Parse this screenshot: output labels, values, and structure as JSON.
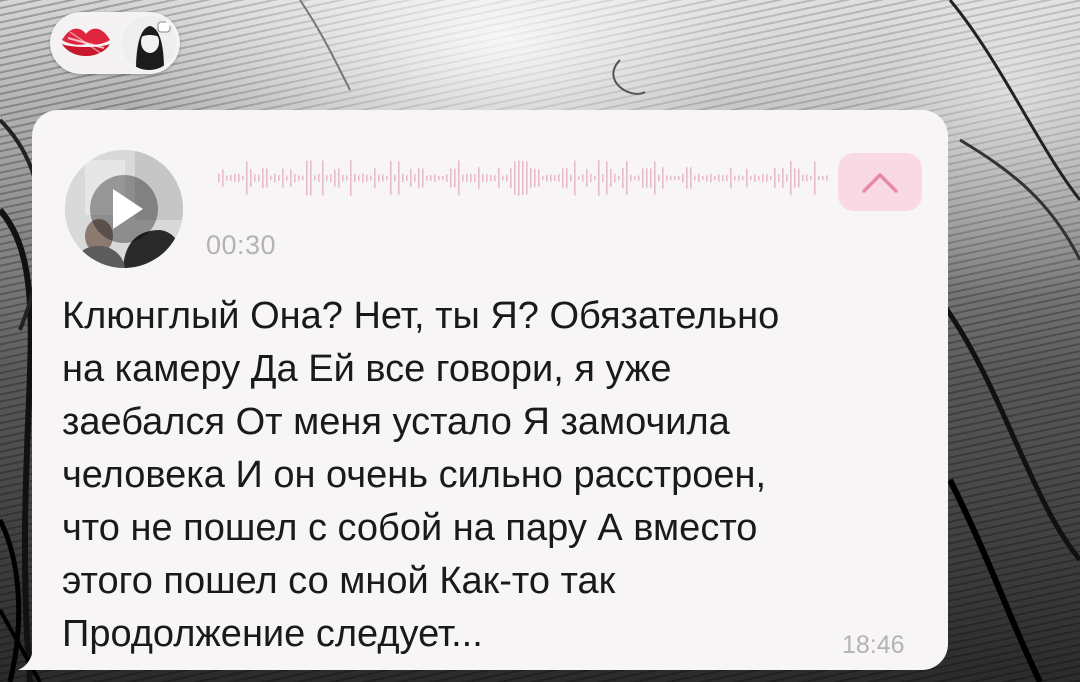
{
  "reactions": {
    "items": [
      {
        "icon": "lips-icon",
        "color": "#e0263e"
      },
      {
        "icon": "user-avatar"
      }
    ]
  },
  "message": {
    "attachment": {
      "type": "video-note",
      "duration": "00:30"
    },
    "transcript": "Клюнглый Она? Нет, ты Я? Обязательно\nна камеру Да Ей все говори, я уже\nзаебался От меня устало Я замочила\nчеловека И он очень сильно расстроен,\nчто не пошел с собой на пару А вместо\nэтого пошел со мной Как-то так\nПродолжение следует...",
    "time": "18:46"
  },
  "colors": {
    "bubble": "#f7f5f6",
    "accent": "#e88aa8",
    "accent_bg": "#f9d9e4",
    "meta_text": "#b4b2b3",
    "text": "#1a1a1a"
  }
}
